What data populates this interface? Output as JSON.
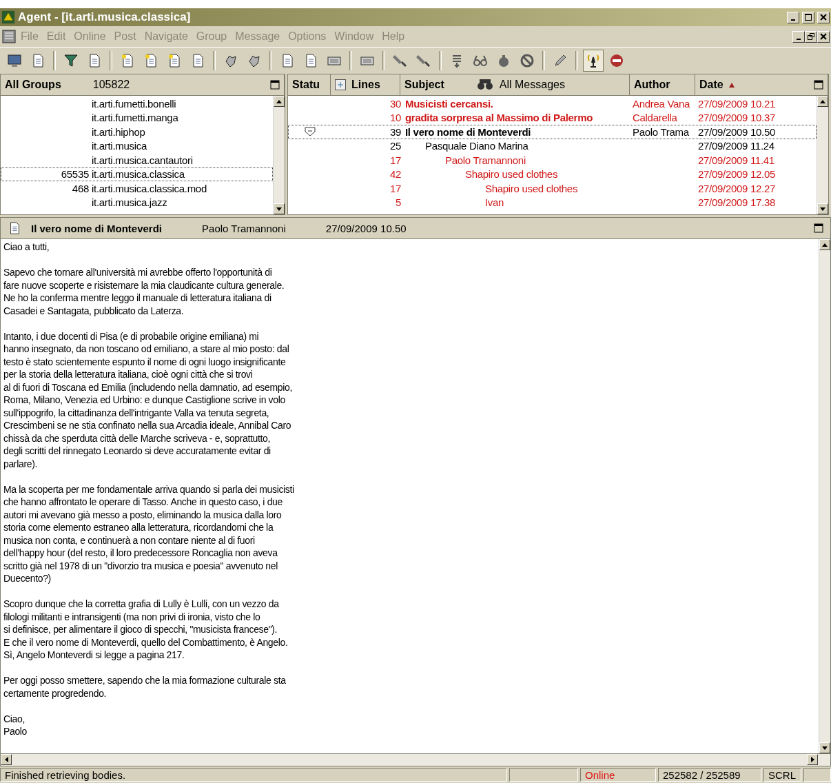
{
  "window": {
    "title": "Agent - [it.arti.musica.classica]"
  },
  "menu": [
    "File",
    "Edit",
    "Online",
    "Post",
    "Navigate",
    "Group",
    "Message",
    "Options",
    "Window",
    "Help"
  ],
  "toolbar": {
    "online_pressed": true
  },
  "groups": {
    "title": "All Groups",
    "count": "105822",
    "items": [
      {
        "name": "it.arti.fumetti.bonelli",
        "selected": false
      },
      {
        "name": "it.arti.fumetti.manga",
        "selected": false
      },
      {
        "name": "it.arti.hiphop",
        "selected": false
      },
      {
        "name": "it.arti.musica",
        "selected": false
      },
      {
        "name": "it.arti.musica.cantautori",
        "selected": false
      },
      {
        "count": "65535",
        "name": "it.arti.musica.classica",
        "selected": true
      },
      {
        "count": "468",
        "name": "it.arti.musica.classica.mod",
        "selected": false
      },
      {
        "name": "it.arti.musica.jazz",
        "selected": false
      }
    ]
  },
  "threads": {
    "columns": [
      "Statu",
      "Lines",
      "Subject",
      "Author",
      "Date"
    ],
    "filter": "All Messages",
    "rows": [
      {
        "lines": "30",
        "subject": "Musicisti cercansi.",
        "author": "Andrea Vana",
        "date": "27/09/2009 10.21",
        "unread": true,
        "bold": true,
        "selected": false,
        "expanded": false
      },
      {
        "lines": "10",
        "subject": "gradita sorpresa al Massimo di Palermo",
        "author": "Caldarella",
        "date": "27/09/2009 10.37",
        "unread": true,
        "bold": true,
        "selected": false,
        "expanded": false
      },
      {
        "lines": "39",
        "subject": "Il vero nome di Monteverdi",
        "author": "Paolo Trama",
        "date": "27/09/2009 10.50",
        "unread": false,
        "bold": true,
        "selected": true,
        "expanded": true,
        "children": [
          {
            "lines": "25",
            "subject": "Pasquale Diano Marina",
            "date": "27/09/2009 11.24",
            "unread": false,
            "bold": false,
            "selected": false,
            "expanded": false,
            "children": [
              {
                "lines": "17",
                "subject": "Paolo Tramannoni",
                "date": "27/09/2009 11.41",
                "unread": true,
                "bold": false,
                "selected": false,
                "expanded": false,
                "children": [
                  {
                    "lines": "42",
                    "subject": "Shapiro used clothes",
                    "date": "27/09/2009 12.05",
                    "unread": true,
                    "bold": false,
                    "selected": false,
                    "expanded": false,
                    "children": [
                      {
                        "lines": "17",
                        "subject": "Shapiro used clothes",
                        "date": "27/09/2009 12.27",
                        "unread": true,
                        "bold": false,
                        "selected": false,
                        "expanded": false
                      },
                      {
                        "lines": "5",
                        "subject": "Ivan",
                        "date": "27/09/2009 17.38",
                        "unread": true,
                        "bold": false,
                        "selected": false,
                        "expanded": false
                      }
                    ]
                  }
                ]
              }
            ]
          }
        ]
      }
    ]
  },
  "message": {
    "subject": "Il vero nome di Monteverdi",
    "author": "Paolo Tramannoni",
    "date": "27/09/2009 10.50",
    "paragraphs": [
      "Ciao a tutti,",
      "Sapevo che tornare all'università mi avrebbe offerto l'opportunità di\nfare nuove scoperte e risistemare la mia claudicante cultura generale.\nNe ho la conferma mentre leggo il manuale di letteratura italiana di\nCasadei e Santagata, pubblicato da Laterza.",
      "Intanto, i due docenti di Pisa (e di probabile origine emiliana) mi\nhanno insegnato, da non toscano od emiliano, a stare al mio posto: dal\ntesto è stato scientemente espunto il nome di ogni luogo insignificante\nper la storia della letteratura italiana, cioè ogni città che si trovi\nal di fuori di Toscana ed Emilia (includendo nella damnatio, ad esempio,\nRoma, Milano, Venezia ed Urbino: e dunque Castiglione scrive in volo\nsull'ippogrifo, la cittadinanza dell'intrigante Valla va tenuta segreta,\nCrescimbeni se ne stia confinato nella sua Arcadia ideale, Annibal Caro\nchissà da che sperduta città delle Marche scriveva - e, soprattutto,\ndegli scritti del rinnegato Leonardo si deve accuratamente evitar di\nparlare).",
      "Ma la scoperta per me fondamentale arriva quando si parla dei musicisti\nche hanno affrontato le operare di Tasso. Anche in questo caso, i due\nautori mi avevano già messo a posto, eliminando la musica dalla loro\nstoria come elemento estraneo alla letteratura, ricordandomi che la\nmusica non conta, e continuerà a non contare niente al di fuori\ndell'happy hour (del resto, il loro predecessore Roncaglia non aveva\nscritto già nel 1978 di un \"divorzio tra musica e poesia\" avvenuto nel\nDuecento?)",
      "Scopro dunque che la corretta grafia di Lully è Lulli, con un vezzo da\nfilologi militanti e intransigenti (ma non privi di ironia, visto che lo\nsi definisce, per alimentare il gioco di specchi, \"musicista francese\").\nE che il vero nome di Monteverdi, quello del Combattimento, è Angelo.\nSì, Angelo Monteverdi si legge a pagina 217.",
      "Per oggi posso smettere, sapendo che la mia formazione culturale sta\ncertamente progredendo.",
      "Ciao,\nPaolo"
    ]
  },
  "status_bar": {
    "message": "Finished retrieving bodies.",
    "connection": "Online",
    "counts": "252582 / 252589",
    "lock": "SCRL"
  }
}
